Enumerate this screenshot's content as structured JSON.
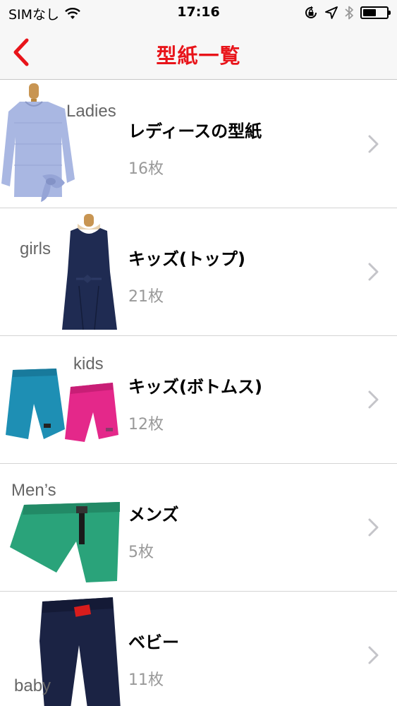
{
  "status_bar": {
    "carrier": "SIMなし",
    "time": "17:16",
    "battery_level": 0.55,
    "icons": [
      "wifi-icon",
      "rotation-lock-icon",
      "location-icon",
      "bluetooth-icon",
      "battery-icon"
    ]
  },
  "nav": {
    "title": "型紙一覧",
    "back_icon": "chevron-left-icon",
    "accent_color": "#e8141a"
  },
  "items": [
    {
      "thumb_label": "Ladies",
      "title": "レディースの型紙",
      "count": "16枚",
      "image": "ladies-blouse-image"
    },
    {
      "thumb_label": "girls",
      "title": "キッズ(トップ)",
      "count": "21枚",
      "image": "girls-dress-image"
    },
    {
      "thumb_label": "kids",
      "title": "キッズ(ボトムス)",
      "count": "12枚",
      "image": "kids-shorts-image"
    },
    {
      "thumb_label": "Men’s",
      "title": "メンズ",
      "count": "5枚",
      "image": "mens-shorts-image"
    },
    {
      "thumb_label": "baby",
      "title": "ベビー",
      "count": "11枚",
      "image": "baby-pants-image"
    }
  ]
}
